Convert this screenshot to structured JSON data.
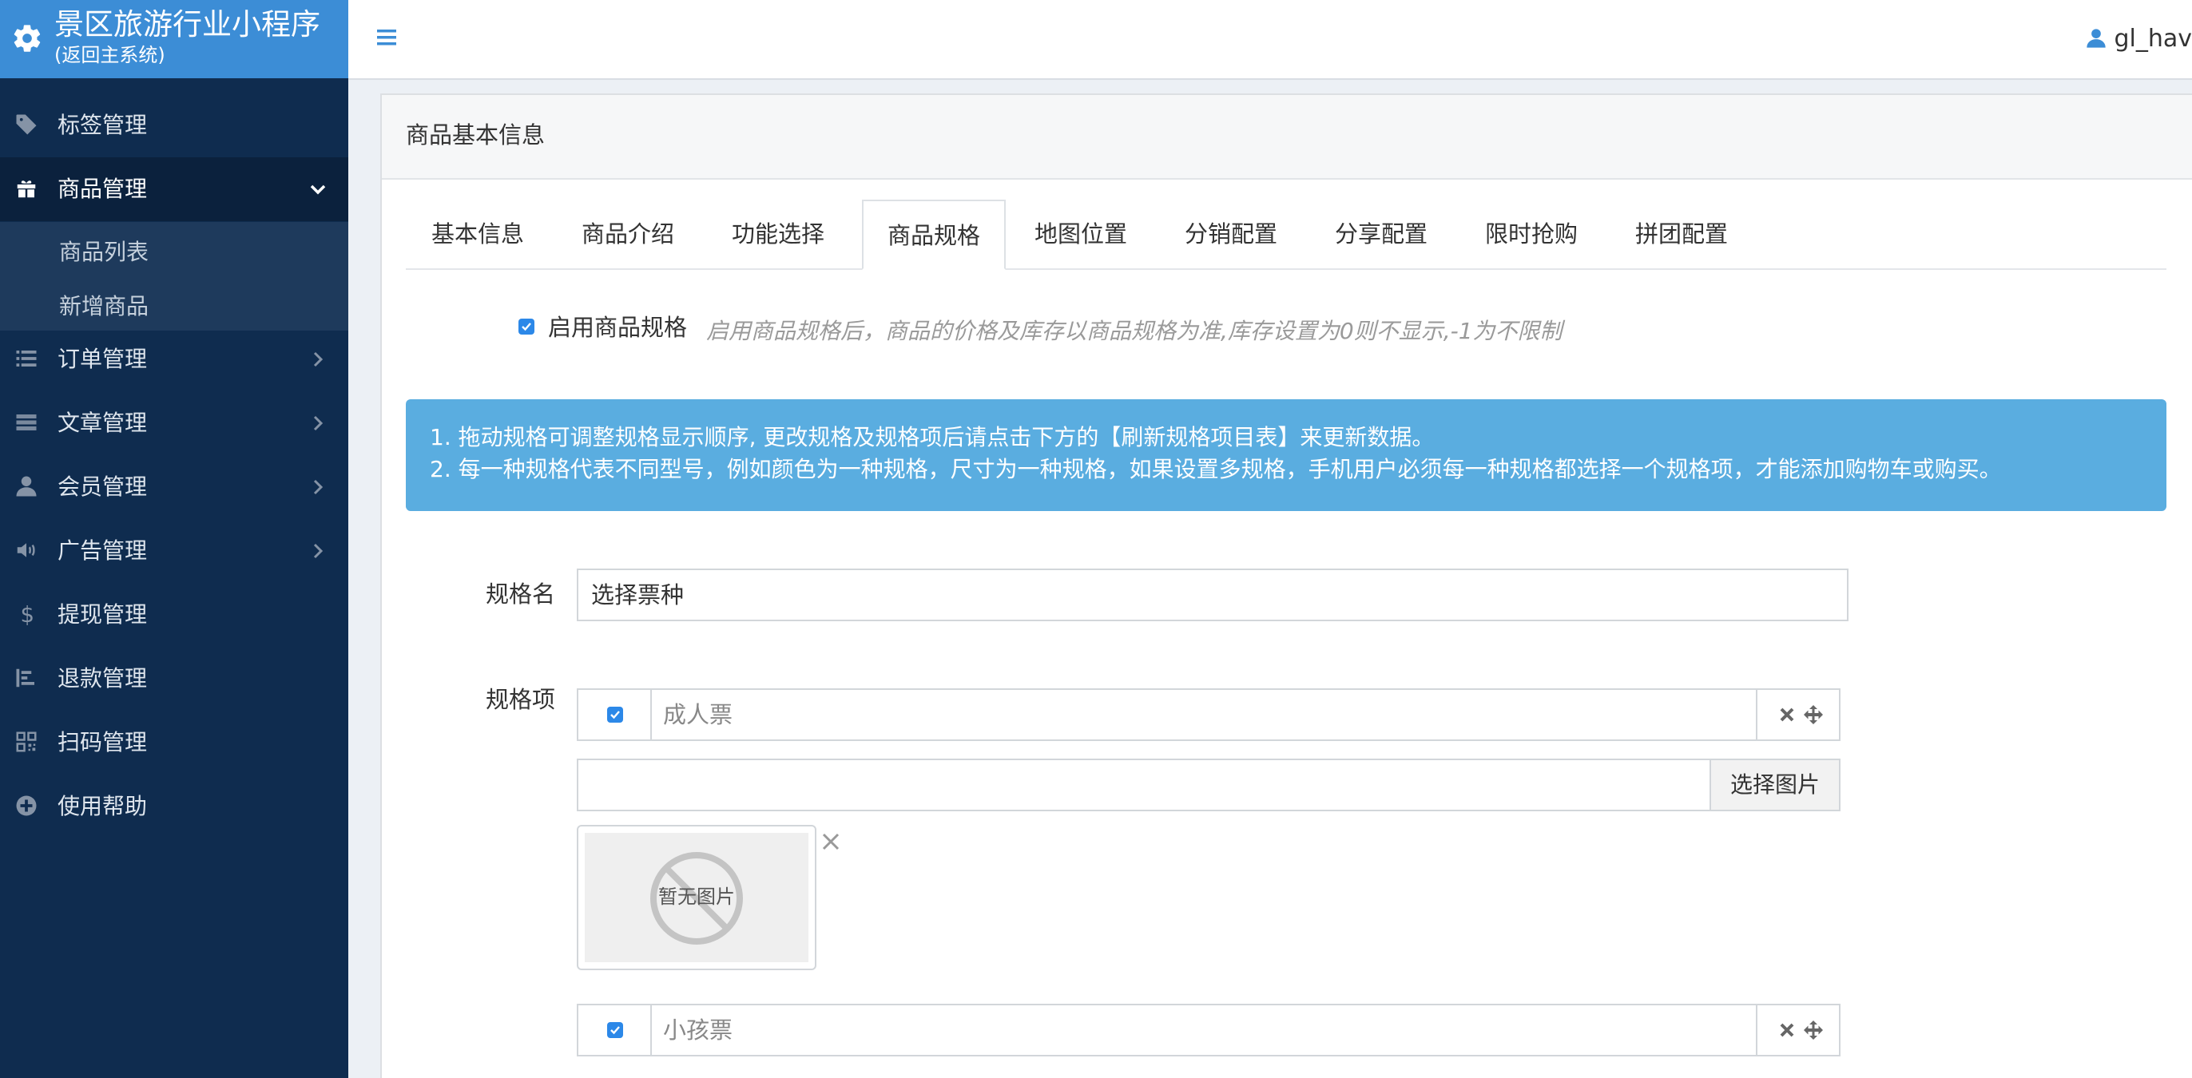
{
  "app": {
    "title": "景区旅游行业小程序",
    "subtitle": "(返回主系统)",
    "user": "gl_hav"
  },
  "sidebar": {
    "items": [
      {
        "label": "标签管理",
        "icon": "tag-icon"
      },
      {
        "label": "商品管理",
        "icon": "gift-icon",
        "active": true,
        "expanded": true
      },
      {
        "label": "订单管理",
        "icon": "list-icon"
      },
      {
        "label": "文章管理",
        "icon": "article-icon"
      },
      {
        "label": "会员管理",
        "icon": "user-icon"
      },
      {
        "label": "广告管理",
        "icon": "speaker-icon"
      },
      {
        "label": "提现管理",
        "icon": "dollar-icon"
      },
      {
        "label": "退款管理",
        "icon": "refund-icon"
      },
      {
        "label": "扫码管理",
        "icon": "qrcode-icon"
      },
      {
        "label": "使用帮助",
        "icon": "help-icon"
      }
    ],
    "submenu": [
      "商品列表",
      "新增商品"
    ]
  },
  "panel": {
    "title": "商品基本信息"
  },
  "tabs": [
    "基本信息",
    "商品介绍",
    "功能选择",
    "商品规格",
    "地图位置",
    "分销配置",
    "分享配置",
    "限时抢购",
    "拼团配置"
  ],
  "active_tab": "商品规格",
  "spec": {
    "enable_label": "启用商品规格",
    "enable_checked": true,
    "enable_hint": "启用商品规格后，商品的价格及库存以商品规格为准,库存设置为0则不显示,-1为不限制",
    "alert_lines": [
      "1. 拖动规格可调整规格显示顺序, 更改规格及规格项后请点击下方的【刷新规格项目表】来更新数据。",
      "2. 每一种规格代表不同型号，例如颜色为一种规格，尺寸为一种规格，如果设置多规格，手机用户必须每一种规格都选择一个规格项，才能添加购物车或购买。"
    ],
    "name_label": "规格名",
    "name_value": "选择票种",
    "items_label": "规格项",
    "items": [
      {
        "value": "成人票",
        "checked": true
      },
      {
        "value": "小孩票",
        "checked": true
      }
    ],
    "select_image_label": "选择图片",
    "no_image_text": "暂无图片"
  },
  "colors": {
    "sidebar_bg": "#0f2c4f",
    "brand_bg": "#3c8dd6",
    "alert_bg": "#5aade0",
    "checkbox": "#2c88e8"
  }
}
